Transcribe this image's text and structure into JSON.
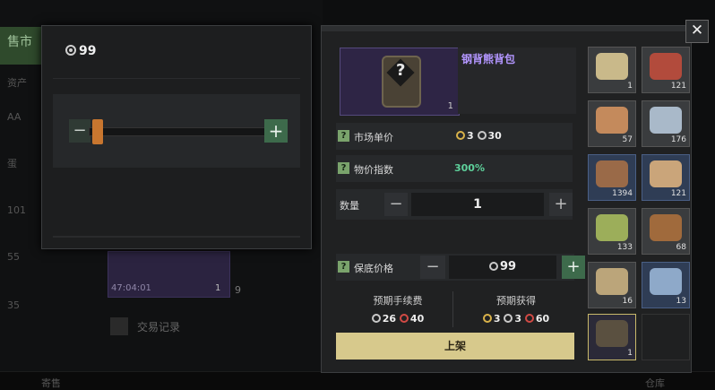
{
  "background": {
    "tab_label": "售市",
    "side_labels": [
      "资产",
      "AA",
      "蛋",
      "101",
      "55",
      "35"
    ],
    "item_time": "47:04:01",
    "item_qty": "1",
    "item_price": "9",
    "record_label": "交易记录",
    "bottom_left": "寄售",
    "bottom_right": "仓库"
  },
  "left_popup": {
    "price": "99"
  },
  "dialog": {
    "item_name": "钢背熊背包",
    "item_qty": "1",
    "market_price_label": "市场单价",
    "market_price_gold": "3",
    "market_price_silver": "30",
    "index_label": "物价指数",
    "index_value": "300%",
    "quantity_label": "数量",
    "quantity_value": "1",
    "guarantee_label": "保底价格",
    "guarantee_value": "99",
    "fee_label": "预期手续费",
    "fee_silver": "26",
    "fee_red": "40",
    "gain_label": "预期获得",
    "gain_gold": "3",
    "gain_silver": "3",
    "gain_red": "60",
    "list_button": "上架",
    "close_label": "✕"
  },
  "inventory": [
    {
      "name": "gold-ore-item",
      "count": "1",
      "color": "#c9b98a",
      "rarity": "grey"
    },
    {
      "name": "berry-item",
      "count": "121",
      "color": "#b24b3c",
      "rarity": "grey"
    },
    {
      "name": "copper-ore-item",
      "count": "57",
      "color": "#c48a5c",
      "rarity": "grey"
    },
    {
      "name": "crystal-ore-item",
      "count": "176",
      "color": "#a9b9c9",
      "rarity": "grey"
    },
    {
      "name": "basket-item",
      "count": "1394",
      "color": "#9a6a48",
      "rarity": "blue"
    },
    {
      "name": "horn-item",
      "count": "121",
      "color": "#caa57a",
      "rarity": "blue"
    },
    {
      "name": "herb-item",
      "count": "133",
      "color": "#9cae5a",
      "rarity": "grey"
    },
    {
      "name": "root-item",
      "count": "68",
      "color": "#a06a3c",
      "rarity": "grey"
    },
    {
      "name": "stone-item",
      "count": "16",
      "color": "#bba57a",
      "rarity": "grey"
    },
    {
      "name": "canister-item",
      "count": "13",
      "color": "#8ea9c9",
      "rarity": "blue"
    },
    {
      "name": "backpack-item",
      "count": "1",
      "color": "#5a5040",
      "rarity": "purple"
    }
  ]
}
